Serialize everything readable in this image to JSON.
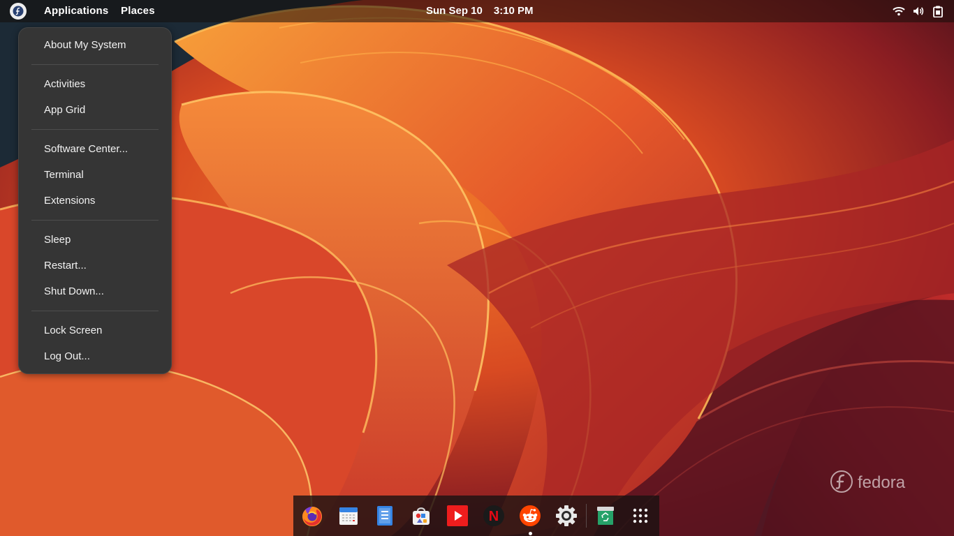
{
  "topbar": {
    "applications_label": "Applications",
    "places_label": "Places",
    "date": "Sun Sep 10",
    "time": "3:10 PM",
    "tray_icons": [
      "wifi-icon",
      "volume-icon",
      "clipboard-icon"
    ]
  },
  "menu": {
    "items": [
      {
        "label": "About My System"
      },
      {
        "label": "Activities"
      },
      {
        "label": "App Grid"
      },
      {
        "label": "Software Center..."
      },
      {
        "label": "Terminal"
      },
      {
        "label": "Extensions"
      },
      {
        "label": "Sleep"
      },
      {
        "label": "Restart..."
      },
      {
        "label": "Shut Down..."
      },
      {
        "label": "Lock Screen"
      },
      {
        "label": "Log Out..."
      }
    ]
  },
  "dock": {
    "apps": [
      {
        "icon": "firefox-icon"
      },
      {
        "icon": "calendar-icon"
      },
      {
        "icon": "text-editor-icon"
      },
      {
        "icon": "software-store-icon"
      },
      {
        "icon": "youtube-icon"
      },
      {
        "icon": "netflix-icon",
        "glyph": "N"
      },
      {
        "icon": "reddit-icon",
        "running": true
      },
      {
        "icon": "settings-icon"
      },
      {
        "icon": "trash-icon"
      },
      {
        "icon": "app-grid-icon"
      }
    ]
  },
  "watermark": {
    "text": "fedora"
  },
  "colors": {
    "menu_bg": "#353535",
    "accent_orange": "#e8632a",
    "fedora_blue": "#51a2da"
  }
}
